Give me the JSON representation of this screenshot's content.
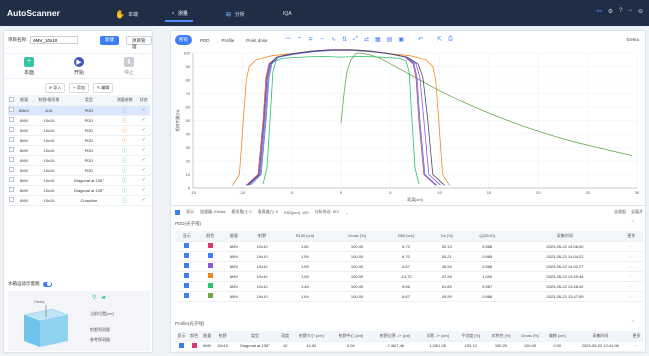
{
  "app": {
    "name": "AutoScanner"
  },
  "nav": [
    {
      "label": "本端",
      "icon": "hand-icon"
    },
    {
      "label": "测量",
      "icon": "measure-icon"
    },
    {
      "label": "分析",
      "icon": "analysis-icon"
    },
    {
      "label": "IQA",
      "icon": ""
    }
  ],
  "left": {
    "project_label": "项目名称:",
    "project_value": "6MV_10x10",
    "new_btn": "新建",
    "manage_btn": "项目管理",
    "actions": {
      "new": "本面",
      "start": "开始",
      "stop": "停止"
    },
    "tools": {
      "import": "导入",
      "add": "添加",
      "edit": "编辑"
    },
    "table_headers": [
      "",
      "能量",
      "射野/楔形角",
      "类型",
      "测量参数",
      "状态"
    ],
    "rows": [
      {
        "energy": "6MeV",
        "field": "A10",
        "type": "PDD",
        "status": "info",
        "sel": true
      },
      {
        "energy": "6MV",
        "field": "10x10",
        "type": "PDD",
        "status": "warn",
        "sel": false
      },
      {
        "energy": "6MV",
        "field": "10x10",
        "type": "PDD",
        "status": "warn",
        "sel": false
      },
      {
        "energy": "6MV",
        "field": "10x10",
        "type": "PDD",
        "status": "warn",
        "sel": false
      },
      {
        "energy": "6MV",
        "field": "10x10",
        "type": "PDD",
        "status": "ok",
        "sel": false
      },
      {
        "energy": "6MV",
        "field": "10x10",
        "type": "PDD",
        "status": "ok",
        "sel": false
      },
      {
        "energy": "6MV",
        "field": "10x10",
        "type": "PDD",
        "status": "ok",
        "sel": false
      },
      {
        "energy": "6MV",
        "field": "10x10",
        "type": "Diagonal at 135°",
        "status": "ok",
        "sel": false
      },
      {
        "energy": "6MV",
        "field": "10x10",
        "type": "Diagonal at 135°",
        "status": "ok",
        "sel": false
      },
      {
        "energy": "6MV",
        "field": "10x10",
        "type": "Crossline",
        "status": "ok",
        "sel": false
      }
    ],
    "tank_title": "水箱运动示意图",
    "tank_labels": {
      "pos": "当前位置[cm]",
      "scan": "射野到测量",
      "ref": "参考探测器"
    },
    "tank_caption": "Gantry"
  },
  "right": {
    "tabs": [
      "所有",
      "PDD",
      "Profile",
      "Point dose"
    ],
    "machine": "Elekta",
    "info": [
      "加速器: Elekta",
      "楔形角[°]: 0",
      "准直器[°]: 0",
      "SSD[cm]: 100",
      "分析协议: IEC"
    ],
    "info_right": [
      "全收起",
      "全展开"
    ],
    "pdd_title": "PDD(光子线)",
    "pdd_headers": [
      "显示",
      "颜色",
      "能量",
      "射野",
      "R100 [cm]",
      "Dmax [%]",
      "R80 [cm]",
      "Ds [%]",
      "Q(20/10)",
      "采集时间",
      "更多"
    ],
    "pdd_rows": [
      {
        "color": "#d63b6b",
        "energy": "6MV",
        "field": "10x10",
        "r100": "1.60",
        "dmax": "100.00",
        "r80": "6.72",
        "ds": "52.13",
        "q": "0.586",
        "time": "2023-05-22 14:06:00"
      },
      {
        "color": "#3d7ef5",
        "energy": "6MV",
        "field": "10x10",
        "r100": "1.59",
        "dmax": "100.00",
        "r80": "6.70",
        "ds": "50.21",
        "q": "0.585",
        "time": "2023-05-22 14:04:22"
      },
      {
        "color": "#8f5ad6",
        "energy": "6MV",
        "field": "10x10",
        "r100": "1.59",
        "dmax": "100.00",
        "r80": "6.67",
        "ds": "46.94",
        "q": "0.586",
        "time": "2023-05-22 14:02:27"
      },
      {
        "color": "#f08a24",
        "energy": "6MV",
        "field": "10x10",
        "r100": "1.59",
        "dmax": "100.00",
        "r80": "-14.72",
        "ds": "47.26",
        "q": "1.000",
        "time": "2023-05-22 13:49:44"
      },
      {
        "color": "#2bbf6a",
        "energy": "6MV",
        "field": "10x10",
        "r100": "1.46",
        "dmax": "100.00",
        "r80": "6.66",
        "ds": "61.69",
        "q": "0.587",
        "time": "2023-05-22 13:48:42"
      },
      {
        "color": "#6aa84f",
        "energy": "6MV",
        "field": "10x10",
        "r100": "1.64",
        "dmax": "100.00",
        "r80": "6.67",
        "ds": "45.99",
        "q": "0.586",
        "time": "2023-05-22 13:47:59"
      }
    ],
    "profile_title": "Profile(光子线)",
    "profile_headers": [
      "显示",
      "颜色",
      "能量",
      "射野",
      "类型",
      "深度",
      "射野大小 [cm]",
      "射野中心 [cm]",
      "射野边界 -/+ [cm]",
      "半影 -/+ [cm]",
      "平坦度 [%]",
      "对称性 [%]",
      "Dmax [%]",
      "偏移 [cm]",
      "采集时间",
      "更多"
    ],
    "profile_rows": [
      {
        "color": "#d63b6b",
        "energy": "6MV",
        "field": "10x10",
        "type": "Diagonal at 135°",
        "depth": "10",
        "size": "14.92",
        "center": "0.00",
        "edge": "-7.46/7.46",
        "pen": "1.28/1.28",
        "flat": "103.12",
        "sym": "100.29",
        "dmax": "100.00",
        "shift": "0.00",
        "time": "2023-05-22 13:41:06"
      }
    ]
  },
  "chart_data": {
    "type": "line",
    "xlabel": "距离[cm]",
    "ylabel": "相对剂量[%]",
    "xlim": [
      -15,
      30
    ],
    "ylim": [
      0,
      100
    ],
    "xticks": [
      -15,
      -10,
      -5,
      0,
      5,
      10,
      15,
      20,
      25,
      30
    ],
    "yticks": [
      0,
      10,
      20,
      30,
      40,
      50,
      60,
      70,
      80,
      90,
      100
    ],
    "series": [
      {
        "color": "#6aa84f",
        "x": [
          0.0,
          0.3,
          0.6,
          1.0,
          1.5,
          2.0,
          3,
          4,
          5,
          6,
          7,
          8,
          10,
          12,
          14,
          16,
          18,
          20,
          22,
          24,
          26,
          28,
          29.5
        ],
        "y": [
          48,
          70,
          86,
          95,
          99.5,
          100,
          98.5,
          96,
          92,
          88,
          84,
          80,
          72,
          65,
          58.5,
          52.5,
          47,
          42,
          37.5,
          33.5,
          30,
          26.5,
          24
        ]
      },
      {
        "color": "#2bbf6a",
        "x": [
          -7.9,
          -7.5,
          -7.2,
          -6.9,
          -6.6,
          -6,
          -4,
          -2,
          0,
          2,
          4,
          6,
          6.6,
          6.9,
          7.2,
          7.5,
          7.9
        ],
        "y": [
          3,
          15,
          50,
          86,
          94,
          96,
          97,
          97.5,
          97,
          97.5,
          97,
          96,
          94,
          86,
          50,
          15,
          3
        ]
      },
      {
        "color": "#f08a24",
        "x": [
          -11.0,
          -10.3,
          -9.9,
          -9.6,
          -9.3,
          -8.6,
          -7,
          -5,
          -3,
          -1,
          1,
          3,
          5,
          7,
          8.6,
          9.3,
          9.6,
          9.9,
          10.3,
          11.0
        ],
        "y": [
          2,
          10,
          50,
          80,
          90,
          95,
          98,
          99.5,
          101,
          102,
          102,
          101,
          99.5,
          98,
          95,
          90,
          80,
          50,
          10,
          2
        ]
      },
      {
        "color": "#d63b6b",
        "x": [
          -9.6,
          -8.4,
          -7.9,
          -7.6,
          -7.3,
          -6.5,
          -5,
          -3,
          -1,
          1,
          3,
          5,
          6.5,
          7.3,
          7.6,
          7.9,
          8.4,
          9.6
        ],
        "y": [
          2,
          10,
          50,
          82,
          92,
          97,
          99.5,
          101.5,
          102.5,
          102.5,
          101.5,
          99.5,
          97,
          92,
          82,
          50,
          10,
          2
        ]
      },
      {
        "color": "#3d7ef5",
        "x": [
          -9.2,
          -8.1,
          -7.6,
          -7.3,
          -7.0,
          -6.3,
          -4.8,
          -2.8,
          -0.8,
          1.2,
          3.2,
          5.2,
          6.6,
          7.4,
          7.7,
          8.0,
          8.5,
          9.7
        ],
        "y": [
          2,
          10,
          50,
          82,
          92,
          97,
          99,
          101,
          102,
          102,
          101,
          99,
          97,
          92,
          82,
          50,
          10,
          2
        ]
      },
      {
        "color": "#8f5ad6",
        "x": [
          -9.4,
          -8.2,
          -7.7,
          -7.4,
          -7.1,
          -6.4,
          -4.9,
          -2.9,
          -0.9,
          1.1,
          3.1,
          5.1,
          6.6,
          7.6,
          8.0,
          8.4,
          8.9,
          10.1
        ],
        "y": [
          2,
          10,
          50,
          82,
          92,
          97,
          99.2,
          101.2,
          102.2,
          102.2,
          101.2,
          99.2,
          97,
          92,
          82,
          50,
          10,
          2
        ]
      },
      {
        "color": "#444e63",
        "x": [
          -9.5,
          -8.3,
          -7.8,
          -7.5,
          -7.2,
          -6.5,
          -5,
          -3,
          -1,
          1,
          3,
          5,
          6.7,
          7.8,
          8.3,
          8.8,
          9.3,
          10.5
        ],
        "y": [
          2,
          10,
          50,
          82,
          92,
          97,
          99.3,
          101.3,
          102.3,
          102.3,
          101.3,
          99.3,
          97,
          92,
          82,
          50,
          10,
          2
        ]
      }
    ]
  }
}
